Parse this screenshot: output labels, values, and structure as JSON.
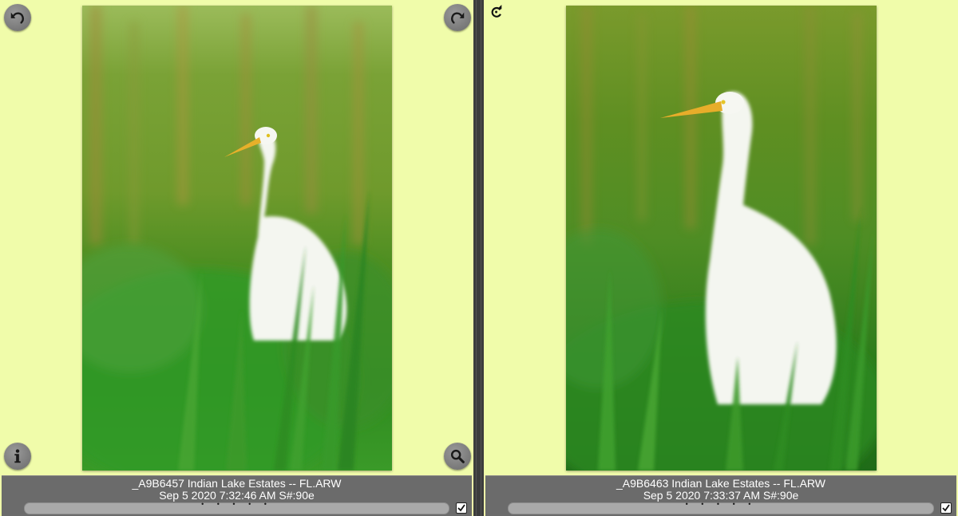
{
  "panes": [
    {
      "filename": "_A9B6457 Indian Lake Estates -- FL.ARW",
      "datetime": "Sep 5 2020 7:32:46 AM S#:90e",
      "dots": "• • • • •",
      "checked": true,
      "icons": [
        "undo-rotate-icon",
        "redo-rotate-icon",
        "info-icon",
        "magnifier-icon",
        "checkbox-icon"
      ]
    },
    {
      "filename": "_A9B6463 Indian Lake Estates -- FL.ARW",
      "datetime": "Sep 5 2020 7:33:37 AM S#:90e",
      "dots": "• • • • •",
      "checked": true,
      "icons": [
        "refresh-icon",
        "checkbox-icon"
      ]
    }
  ],
  "colors": {
    "pane_background": "#f0fcaa",
    "caption_background": "#6b6b6b",
    "divider": "#3c3c3c",
    "button_gray": "#7d7d7d"
  }
}
